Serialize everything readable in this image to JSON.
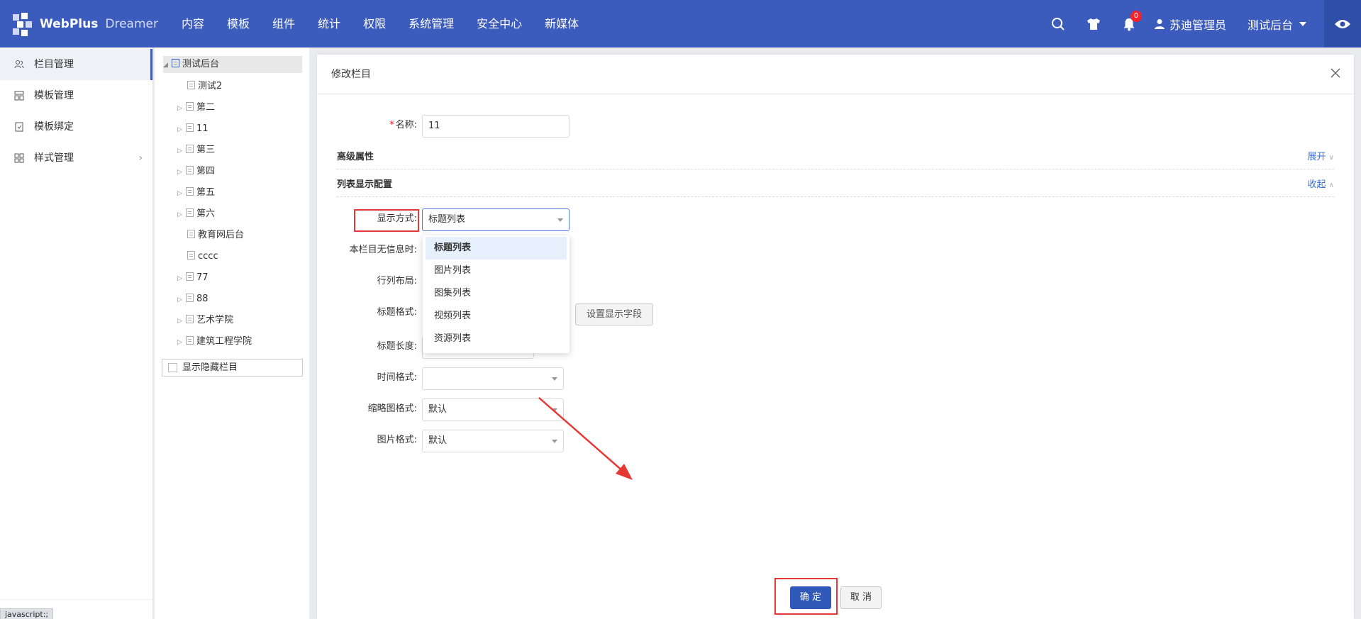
{
  "header": {
    "brand": "WebPlus",
    "brand_sub": "Dreamer",
    "nav": [
      "内容",
      "模板",
      "组件",
      "统计",
      "权限",
      "系统管理",
      "安全中心",
      "新媒体"
    ],
    "notification_count": "0",
    "user_name": "苏迪管理员",
    "site_name": "测试后台",
    "bg_color": "#3b5bbd"
  },
  "sidebar": {
    "items": [
      {
        "label": "栏目管理",
        "icon": "people-icon",
        "active": true
      },
      {
        "label": "模板管理",
        "icon": "template-icon"
      },
      {
        "label": "模板绑定",
        "icon": "bind-icon"
      },
      {
        "label": "样式管理",
        "icon": "grid-icon",
        "has_children": true
      }
    ]
  },
  "status_bar": {
    "url": "javascript:;"
  },
  "tree": {
    "root": "测试后台",
    "nodes": [
      "测试2",
      "第二",
      "11",
      "第三",
      "第四",
      "第五",
      "第六",
      "教育网后台",
      "cccc",
      "77",
      "88",
      "艺术学院",
      "建筑工程学院"
    ],
    "show_hidden_label": "显示隐藏栏目"
  },
  "modal": {
    "title": "修改栏目",
    "name_label": "名称:",
    "name_value": "11",
    "advanced_label": "高级属性",
    "advanced_toggle": "展开",
    "list_config_label": "列表显示配置",
    "list_config_toggle": "收起",
    "display_mode_label": "显示方式:",
    "display_mode_value": "标题列表",
    "empty_label": "本栏目无信息时:",
    "layout_label": "行列布局:",
    "title_format_label": "标题格式:",
    "set_fields_button": "设置显示字段",
    "title_length_label": "标题长度:",
    "time_format_label": "时间格式:",
    "time_format_value": "",
    "thumb_format_label": "缩略图格式:",
    "thumb_format_value": "默认",
    "image_format_label": "图片格式:",
    "image_format_value": "默认",
    "dropdown_options": [
      "标题列表",
      "图片列表",
      "图集列表",
      "视频列表",
      "资源列表"
    ],
    "dropdown_selected": "标题列表",
    "ok_button": "确 定",
    "cancel_button": "取 消"
  }
}
